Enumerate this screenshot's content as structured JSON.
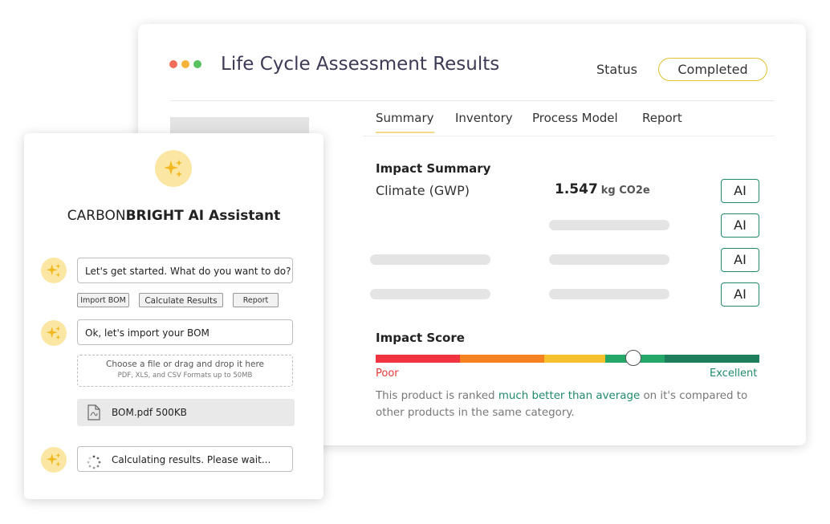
{
  "main": {
    "title": "Life Cycle Assessment Results",
    "window_dots": [
      "#f26b5b",
      "#f5b33a",
      "#59c25f"
    ],
    "status": {
      "label": "Status",
      "value": "Completed"
    },
    "tabs": [
      {
        "label": "Summary",
        "active": true
      },
      {
        "label": "Inventory",
        "active": false
      },
      {
        "label": "Process Model",
        "active": false
      },
      {
        "label": "Report",
        "active": false
      }
    ],
    "impact_summary": {
      "title": "Impact Summary",
      "rows": [
        {
          "label": "Climate (GWP)",
          "value": "1.547",
          "unit": "kg CO2e",
          "ai_label": "AI"
        },
        {
          "ai_label": "AI"
        },
        {
          "ai_label": "AI"
        },
        {
          "ai_label": "AI"
        }
      ]
    },
    "impact_score": {
      "title": "Impact Score",
      "segments": [
        "#ef3340",
        "#f58220",
        "#f5c12e",
        "#25a76a",
        "#1f7f5c"
      ],
      "score_fraction": 0.67,
      "min_label": "Poor",
      "max_label": "Excellent",
      "text_before": "This product is ranked ",
      "text_highlight": "much better than average",
      "text_after": " on it's compared to other products in the same category."
    }
  },
  "assistant": {
    "brand_light": "CARBON",
    "brand_bold": "BRIGHT AI Assistant",
    "icon": "sparkle-icon",
    "messages": {
      "greeting": "Let's get started. What do you want to do?",
      "import": "Ok, let's import your BOM",
      "calculating": "Calculating results. Please wait..."
    },
    "options": [
      "Import BOM",
      "Calculate Results",
      "Report"
    ],
    "dropzone": {
      "line1": "Choose a file or drag and drop it here",
      "line2": "PDF, XLS, and CSV Formats up to 50MB"
    },
    "file": "BOM.pdf 500KB"
  }
}
